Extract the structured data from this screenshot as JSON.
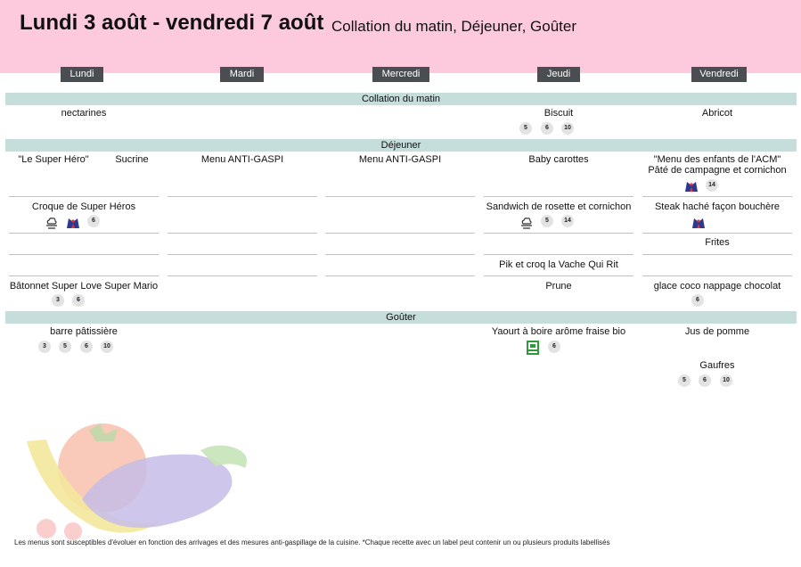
{
  "header": {
    "title": "Lundi 3 août - vendredi 7 août",
    "subtitle": "Collation du matin, Déjeuner, Goûter"
  },
  "days": [
    "Lundi",
    "Mardi",
    "Mercredi",
    "Jeudi",
    "Vendredi"
  ],
  "sections": {
    "collation": "Collation du matin",
    "dejeuner": "Déjeuner",
    "gouter": "Goûter"
  },
  "collation": {
    "lundi": "nectarines",
    "jeudi": "Biscuit",
    "jeudi_allergens": [
      "5",
      "6",
      "10"
    ],
    "vendredi": "Abricot"
  },
  "dejeuner": {
    "lundi": {
      "label_a": "\"Le Super Héro\"",
      "label_b": "Sucrine",
      "plat": "Croque de Super Héros",
      "plat_allergens": [
        "6"
      ],
      "dessert": "Bâtonnet Super Love Super Mario",
      "dessert_allergens": [
        "3",
        "6"
      ]
    },
    "mardi": {
      "entree": "Menu ANTI-GASPI"
    },
    "mercredi": {
      "entree": "Menu ANTI-GASPI"
    },
    "jeudi": {
      "entree": "Baby carottes",
      "plat": "Sandwich de rosette et cornichon",
      "plat_allergens": [
        "5",
        "14"
      ],
      "laitage": "Pik et croq la Vache Qui Rit",
      "dessert": "Prune"
    },
    "vendredi": {
      "title": "\"Menu des enfants de l'ACM\"",
      "entree": "Pâté de campagne et cornichon",
      "entree_allergens": [
        "14"
      ],
      "plat": "Steak haché façon bouchère",
      "garniture": "Frites",
      "dessert": "glace coco nappage chocolat",
      "dessert_allergens": [
        "6"
      ]
    }
  },
  "gouter": {
    "lundi": {
      "item": "barre pâtissière",
      "allergens": [
        "3",
        "5",
        "6",
        "10"
      ]
    },
    "jeudi": {
      "item": "Yaourt à boire arôme fraise bio",
      "allergens": [
        "6"
      ]
    },
    "vendredi": {
      "item1": "Jus de pomme",
      "item2": "Gaufres",
      "item2_allergens": [
        "5",
        "6",
        "10"
      ]
    }
  },
  "icons": {
    "chef": "chef-hat-icon",
    "france": "origine-france-icon",
    "bio": "bio-ab-icon"
  },
  "colors": {
    "header": "#fcc9dd",
    "section": "#c5dddb",
    "day_label": "#4a4e52",
    "bio": "#2e9a3a"
  },
  "footer": "Les menus sont susceptibles d'évoluer en fonction des arrivages et des mesures anti-gaspillage de la cuisine. *Chaque recette avec un label peut contenir un ou plusieurs produits labellisés"
}
